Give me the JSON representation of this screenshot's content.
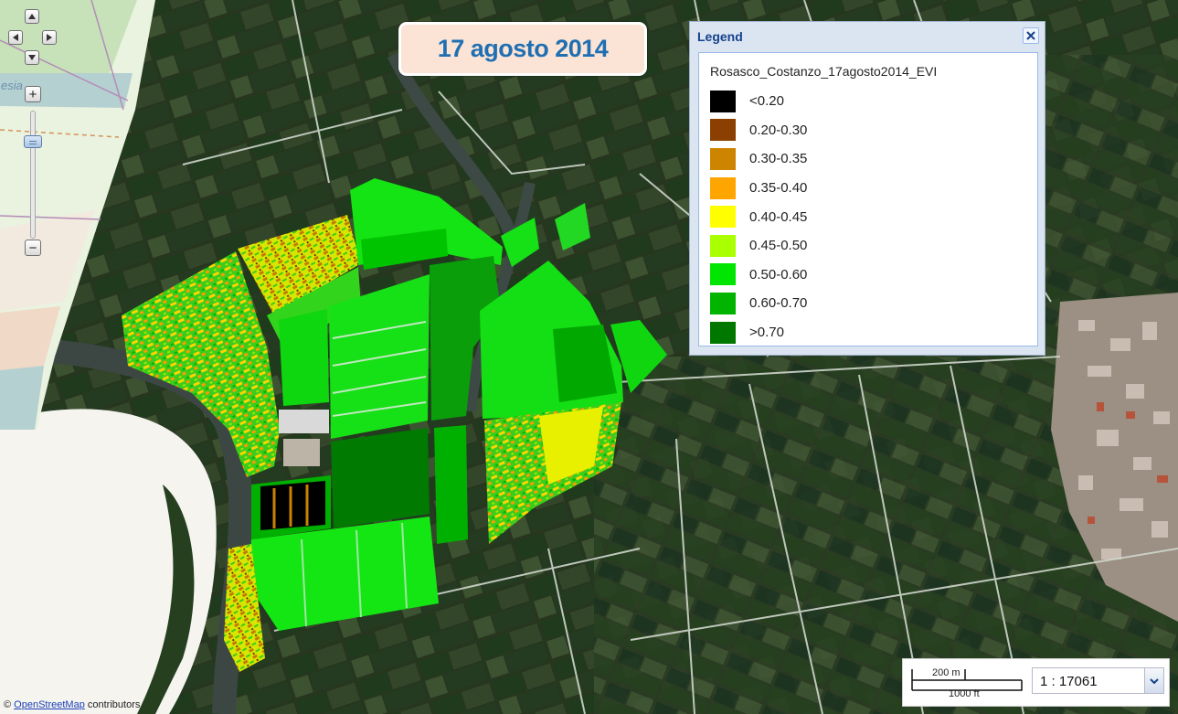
{
  "banner": {
    "date": "17 agosto 2014"
  },
  "basemap": {
    "place_label": "esia"
  },
  "legend": {
    "title": "Legend",
    "layer_name": "Rosasco_Costanzo_17agosto2014_EVI",
    "items": [
      {
        "label": "<0.20",
        "color": "#000000"
      },
      {
        "label": "0.20-0.30",
        "color": "#8b3f00"
      },
      {
        "label": "0.30-0.35",
        "color": "#cd8500"
      },
      {
        "label": "0.35-0.40",
        "color": "#ffa500"
      },
      {
        "label": "0.40-0.45",
        "color": "#ffff00"
      },
      {
        "label": "0.45-0.50",
        "color": "#aaff00"
      },
      {
        "label": "0.50-0.60",
        "color": "#00e600"
      },
      {
        "label": "0.60-0.70",
        "color": "#00b400"
      },
      {
        "label": ">0.70",
        "color": "#007800"
      }
    ]
  },
  "scale": {
    "metric_label": "200 m",
    "imperial_label": "1000 ft",
    "ratio": "1 : 17061"
  },
  "attribution": {
    "prefix": "©",
    "link": "OpenStreetMap",
    "suffix": "contributors"
  },
  "icons": {
    "pan": [
      "pan-up-icon",
      "pan-left-icon",
      "pan-right-icon",
      "pan-down-icon"
    ],
    "zoom": [
      "zoom-in-icon",
      "zoom-out-icon"
    ],
    "legend_close": "close-icon",
    "scale_dropdown": "chevron-down-icon"
  }
}
